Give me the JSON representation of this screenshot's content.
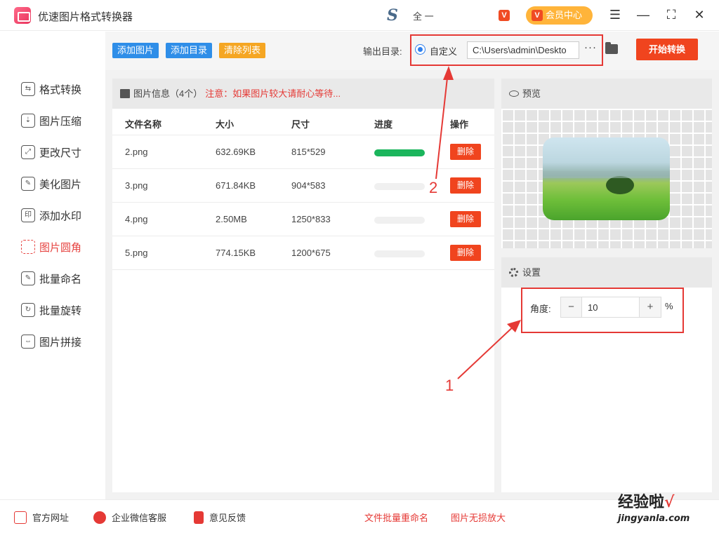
{
  "app": {
    "title": "优速图片格式转换器",
    "center_logo_glyph": "S",
    "center_logo_text": "全 一",
    "vip_label": "会员中心",
    "vip_icon": "V",
    "menu_icon": "☰",
    "min_icon": "—",
    "max_icon": "⛶",
    "close_icon": "✕"
  },
  "sidebar": {
    "items": [
      {
        "label": "格式转换",
        "icon": "format-convert-icon",
        "glyph": "⇆"
      },
      {
        "label": "图片压缩",
        "icon": "compress-icon",
        "glyph": "⇣"
      },
      {
        "label": "更改尺寸",
        "icon": "resize-icon",
        "glyph": "⤢"
      },
      {
        "label": "美化图片",
        "icon": "beautify-icon",
        "glyph": "✎"
      },
      {
        "label": "添加水印",
        "icon": "watermark-icon",
        "glyph": "印"
      },
      {
        "label": "图片圆角",
        "icon": "rounded-corner-icon",
        "glyph": ""
      },
      {
        "label": "批量命名",
        "icon": "rename-icon",
        "glyph": "✎"
      },
      {
        "label": "批量旋转",
        "icon": "rotate-icon",
        "glyph": "↻"
      },
      {
        "label": "图片拼接",
        "icon": "stitch-icon",
        "glyph": "⇔"
      }
    ],
    "active_index": 5
  },
  "toolbar": {
    "add_image": "添加图片",
    "add_dir": "添加目录",
    "clear_list": "清除列表",
    "output_label": "输出目录:",
    "radio_label": "自定义",
    "output_path": "C:\\Users\\admin\\Deskto",
    "more": "···",
    "start": "开始转换"
  },
  "file_panel": {
    "title": "图片信息（4个）",
    "warning": "注意：如果图片较大请耐心等待...",
    "columns": [
      "文件名称",
      "大小",
      "尺寸",
      "进度",
      "操作"
    ],
    "rows": [
      {
        "name": "2.png",
        "size": "632.69KB",
        "dim": "815*529",
        "progress": 1.0,
        "action": "删除"
      },
      {
        "name": "3.png",
        "size": "671.84KB",
        "dim": "904*583",
        "progress": 0,
        "action": "删除"
      },
      {
        "name": "4.png",
        "size": "2.50MB",
        "dim": "1250*833",
        "progress": 0,
        "action": "删除"
      },
      {
        "name": "5.png",
        "size": "774.15KB",
        "dim": "1200*675",
        "progress": 0,
        "action": "删除"
      }
    ]
  },
  "preview": {
    "title": "预览"
  },
  "settings": {
    "title": "设置",
    "angle_label": "角度:",
    "minus": "−",
    "plus": "+",
    "angle_value": "10",
    "unit": "%"
  },
  "annotations": {
    "one": "1",
    "two": "2"
  },
  "footer": {
    "site": "官方网址",
    "wechat": "企业微信客服",
    "feedback": "意见反馈",
    "rename": "文件批量重命名",
    "enlarge": "图片无损放大"
  },
  "watermark": {
    "text": "经验啦",
    "check": "√",
    "url": "jingyanla.com"
  },
  "colors": {
    "accent": "#f0441e",
    "blue": "#2f8ee8",
    "orange": "#f5a623",
    "progress": "#1bb55c",
    "annotation": "#e53935"
  }
}
